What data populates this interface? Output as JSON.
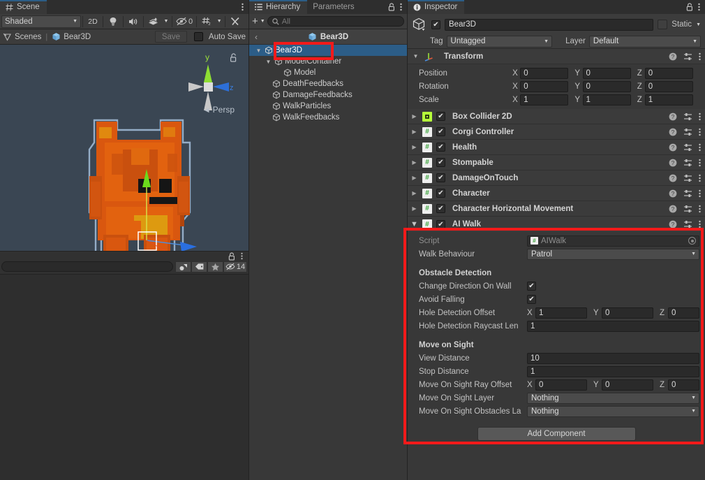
{
  "scene_panel": {
    "tab_label": "Scene",
    "tab_icon": "grid-icon",
    "shading_mode": "Shaded",
    "toolbar": {
      "mode_2d": "2D",
      "light_icon": "lightbulb-icon",
      "audio_icon": "speaker-icon",
      "fx_icon": "effects-icon",
      "hidden_count": "0",
      "grid_icon": "grid-snap-icon",
      "tools_icon": "tools-icon"
    },
    "subbar": {
      "scenes_label": "Scenes",
      "separator": "|",
      "scene_name": "Bear3D",
      "save_label": "Save",
      "autosave_label": "Auto Save"
    },
    "viewport": {
      "projection_label": "Persp",
      "gizmo_axis_y": "y",
      "gizmo_axis_z": "z"
    },
    "bottom_bar": {
      "search_placeholder": "",
      "hidden_objects_count": "14"
    }
  },
  "hierarchy_panel": {
    "tabs": [
      {
        "label": "Hierarchy",
        "active": true,
        "icon": "hierarchy-icon"
      },
      {
        "label": "Parameters",
        "active": false
      }
    ],
    "toolbar": {
      "add_label": "+",
      "search_placeholder": "All"
    },
    "breadcrumb": "Bear3D",
    "tree": [
      {
        "label": "Bear3D",
        "indent": 0,
        "selected": true,
        "foldout": "open"
      },
      {
        "label": "ModelContainer",
        "indent": 1,
        "selected": false,
        "foldout": "open"
      },
      {
        "label": "Model",
        "indent": 2,
        "selected": false,
        "foldout": "none"
      },
      {
        "label": "DeathFeedbacks",
        "indent": 1,
        "selected": false,
        "foldout": "none"
      },
      {
        "label": "DamageFeedbacks",
        "indent": 1,
        "selected": false,
        "foldout": "none"
      },
      {
        "label": "WalkParticles",
        "indent": 1,
        "selected": false,
        "foldout": "none"
      },
      {
        "label": "WalkFeedbacks",
        "indent": 1,
        "selected": false,
        "foldout": "none"
      }
    ]
  },
  "inspector": {
    "tab_label": "Inspector",
    "object_name": "Bear3D",
    "enabled": true,
    "static_label": "Static",
    "tag_label": "Tag",
    "tag_value": "Untagged",
    "layer_label": "Layer",
    "layer_value": "Default",
    "transform": {
      "title": "Transform",
      "rows": [
        {
          "label": "Position",
          "x": "0",
          "y": "0",
          "z": "0"
        },
        {
          "label": "Rotation",
          "x": "0",
          "y": "0",
          "z": "0"
        },
        {
          "label": "Scale",
          "x": "1",
          "y": "1",
          "z": "1"
        }
      ]
    },
    "components": [
      {
        "name": "Box Collider 2D",
        "icon": "box-collider-2d-icon",
        "enabled": true
      },
      {
        "name": "Corgi Controller",
        "icon": "script-icon",
        "enabled": true
      },
      {
        "name": "Health",
        "icon": "script-icon",
        "enabled": true
      },
      {
        "name": "Stompable",
        "icon": "script-icon",
        "enabled": true
      },
      {
        "name": "DamageOnTouch",
        "icon": "script-icon",
        "enabled": true
      },
      {
        "name": "Character",
        "icon": "script-icon",
        "enabled": true
      },
      {
        "name": "Character Horizontal Movement",
        "icon": "script-icon",
        "enabled": true
      }
    ],
    "ai_walk": {
      "title": "AI Walk",
      "enabled": true,
      "script_label": "Script",
      "script_value": "AIWalk",
      "walk_behaviour_label": "Walk Behaviour",
      "walk_behaviour_value": "Patrol",
      "obstacle_header": "Obstacle Detection",
      "change_direction_label": "Change Direction On Wall",
      "change_direction_value": true,
      "avoid_falling_label": "Avoid Falling",
      "avoid_falling_value": true,
      "hole_offset_label": "Hole Detection Offset",
      "hole_offset_x": "1",
      "hole_offset_y": "0",
      "hole_offset_z": "0",
      "hole_raycast_label": "Hole Detection Raycast Len",
      "hole_raycast_value": "1",
      "move_sight_header": "Move on Sight",
      "view_distance_label": "View Distance",
      "view_distance_value": "10",
      "stop_distance_label": "Stop Distance",
      "stop_distance_value": "1",
      "ray_offset_label": "Move On Sight Ray Offset",
      "ray_offset_x": "0",
      "ray_offset_y": "0",
      "ray_offset_z": "0",
      "sight_layer_label": "Move On Sight Layer",
      "sight_layer_value": "Nothing",
      "sight_obstacles_label": "Move On Sight Obstacles La",
      "sight_obstacles_value": "Nothing"
    },
    "add_component_label": "Add Component"
  },
  "highlights": {
    "color": "#f21a1a",
    "boxes": [
      {
        "name": "hierarchy-selection-highlight"
      },
      {
        "name": "ai-walk-component-highlight"
      }
    ]
  }
}
